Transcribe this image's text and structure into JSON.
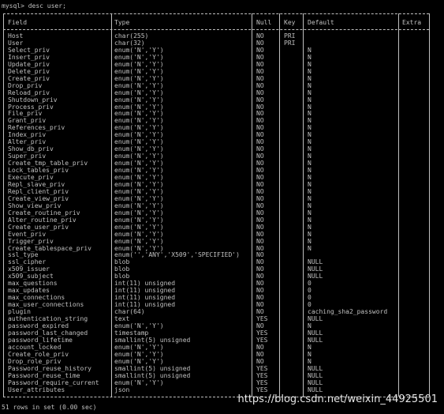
{
  "prompt": "mysql> desc user;",
  "columns": [
    "Field",
    "Type",
    "Null",
    "Key",
    "Default",
    "Extra"
  ],
  "rows": [
    [
      "Host",
      "char(255)",
      "NO",
      "PRI",
      "",
      ""
    ],
    [
      "User",
      "char(32)",
      "NO",
      "PRI",
      "",
      ""
    ],
    [
      "Select_priv",
      "enum('N','Y')",
      "NO",
      "",
      "N",
      ""
    ],
    [
      "Insert_priv",
      "enum('N','Y')",
      "NO",
      "",
      "N",
      ""
    ],
    [
      "Update_priv",
      "enum('N','Y')",
      "NO",
      "",
      "N",
      ""
    ],
    [
      "Delete_priv",
      "enum('N','Y')",
      "NO",
      "",
      "N",
      ""
    ],
    [
      "Create_priv",
      "enum('N','Y')",
      "NO",
      "",
      "N",
      ""
    ],
    [
      "Drop_priv",
      "enum('N','Y')",
      "NO",
      "",
      "N",
      ""
    ],
    [
      "Reload_priv",
      "enum('N','Y')",
      "NO",
      "",
      "N",
      ""
    ],
    [
      "Shutdown_priv",
      "enum('N','Y')",
      "NO",
      "",
      "N",
      ""
    ],
    [
      "Process_priv",
      "enum('N','Y')",
      "NO",
      "",
      "N",
      ""
    ],
    [
      "File_priv",
      "enum('N','Y')",
      "NO",
      "",
      "N",
      ""
    ],
    [
      "Grant_priv",
      "enum('N','Y')",
      "NO",
      "",
      "N",
      ""
    ],
    [
      "References_priv",
      "enum('N','Y')",
      "NO",
      "",
      "N",
      ""
    ],
    [
      "Index_priv",
      "enum('N','Y')",
      "NO",
      "",
      "N",
      ""
    ],
    [
      "Alter_priv",
      "enum('N','Y')",
      "NO",
      "",
      "N",
      ""
    ],
    [
      "Show_db_priv",
      "enum('N','Y')",
      "NO",
      "",
      "N",
      ""
    ],
    [
      "Super_priv",
      "enum('N','Y')",
      "NO",
      "",
      "N",
      ""
    ],
    [
      "Create_tmp_table_priv",
      "enum('N','Y')",
      "NO",
      "",
      "N",
      ""
    ],
    [
      "Lock_tables_priv",
      "enum('N','Y')",
      "NO",
      "",
      "N",
      ""
    ],
    [
      "Execute_priv",
      "enum('N','Y')",
      "NO",
      "",
      "N",
      ""
    ],
    [
      "Repl_slave_priv",
      "enum('N','Y')",
      "NO",
      "",
      "N",
      ""
    ],
    [
      "Repl_client_priv",
      "enum('N','Y')",
      "NO",
      "",
      "N",
      ""
    ],
    [
      "Create_view_priv",
      "enum('N','Y')",
      "NO",
      "",
      "N",
      ""
    ],
    [
      "Show_view_priv",
      "enum('N','Y')",
      "NO",
      "",
      "N",
      ""
    ],
    [
      "Create_routine_priv",
      "enum('N','Y')",
      "NO",
      "",
      "N",
      ""
    ],
    [
      "Alter_routine_priv",
      "enum('N','Y')",
      "NO",
      "",
      "N",
      ""
    ],
    [
      "Create_user_priv",
      "enum('N','Y')",
      "NO",
      "",
      "N",
      ""
    ],
    [
      "Event_priv",
      "enum('N','Y')",
      "NO",
      "",
      "N",
      ""
    ],
    [
      "Trigger_priv",
      "enum('N','Y')",
      "NO",
      "",
      "N",
      ""
    ],
    [
      "Create_tablespace_priv",
      "enum('N','Y')",
      "NO",
      "",
      "N",
      ""
    ],
    [
      "ssl_type",
      "enum('','ANY','X509','SPECIFIED')",
      "NO",
      "",
      "",
      ""
    ],
    [
      "ssl_cipher",
      "blob",
      "NO",
      "",
      "NULL",
      ""
    ],
    [
      "x509_issuer",
      "blob",
      "NO",
      "",
      "NULL",
      ""
    ],
    [
      "x509_subject",
      "blob",
      "NO",
      "",
      "NULL",
      ""
    ],
    [
      "max_questions",
      "int(11) unsigned",
      "NO",
      "",
      "0",
      ""
    ],
    [
      "max_updates",
      "int(11) unsigned",
      "NO",
      "",
      "0",
      ""
    ],
    [
      "max_connections",
      "int(11) unsigned",
      "NO",
      "",
      "0",
      ""
    ],
    [
      "max_user_connections",
      "int(11) unsigned",
      "NO",
      "",
      "0",
      ""
    ],
    [
      "plugin",
      "char(64)",
      "NO",
      "",
      "caching_sha2_password",
      ""
    ],
    [
      "authentication_string",
      "text",
      "YES",
      "",
      "NULL",
      ""
    ],
    [
      "password_expired",
      "enum('N','Y')",
      "NO",
      "",
      "N",
      ""
    ],
    [
      "password_last_changed",
      "timestamp",
      "YES",
      "",
      "NULL",
      ""
    ],
    [
      "password_lifetime",
      "smallint(5) unsigned",
      "YES",
      "",
      "NULL",
      ""
    ],
    [
      "account_locked",
      "enum('N','Y')",
      "NO",
      "",
      "N",
      ""
    ],
    [
      "Create_role_priv",
      "enum('N','Y')",
      "NO",
      "",
      "N",
      ""
    ],
    [
      "Drop_role_priv",
      "enum('N','Y')",
      "NO",
      "",
      "N",
      ""
    ],
    [
      "Password_reuse_history",
      "smallint(5) unsigned",
      "YES",
      "",
      "NULL",
      ""
    ],
    [
      "Password_reuse_time",
      "smallint(5) unsigned",
      "YES",
      "",
      "NULL",
      ""
    ],
    [
      "Password_require_current",
      "enum('N','Y')",
      "YES",
      "",
      "NULL",
      ""
    ],
    [
      "User_attributes",
      "json",
      "YES",
      "",
      "NULL",
      ""
    ]
  ],
  "footer": "51 rows in set (0.00 sec)",
  "watermark": "https://blog.csdn.net/weixin_44925501",
  "colors": {
    "background": "#000000",
    "text": "#c0c0c0",
    "watermark": "#e6e6e6"
  }
}
